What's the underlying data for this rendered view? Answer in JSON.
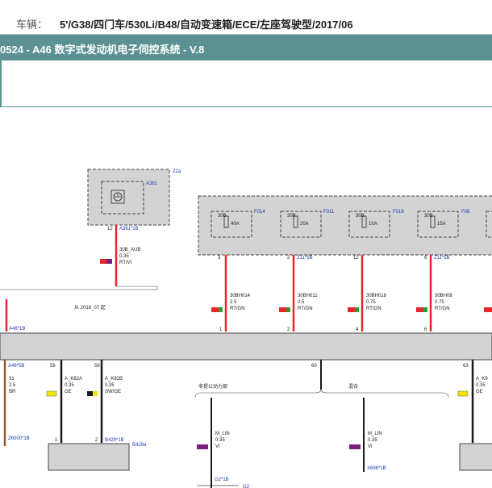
{
  "vehicle": {
    "label": "车辆：",
    "value": "5'/G38/四门车/530Li/B48/自动变速箱/ECE/左座驾驶型/2017/06"
  },
  "title": "0524 - A46 数字式发动机电子伺控系统 - V.8",
  "colors": {
    "title_bg": "#5b9193",
    "wire_red": "#e8252a",
    "wire_black": "#1a1a1a",
    "wire_brown": "#8b5a2b",
    "component_fill": "#d3d3d3"
  },
  "component_z2a": {
    "ref": "Z2a",
    "connector": "A361",
    "connector_pin": "A361*1B",
    "pin": "12",
    "icon": "ground-symbol-icon"
  },
  "wire_a361": {
    "name": "30B_AUB",
    "gauge": "0.35",
    "color": "RT/VI"
  },
  "note_2016": "从 2016_07 起",
  "fuses": [
    {
      "ref": "F014",
      "label": "30B",
      "rating": "40A",
      "pin": "3",
      "wire": "30BH014",
      "gauge": "2.5",
      "color": "RT/GN",
      "bottom_pin": "1"
    },
    {
      "ref": "F011",
      "label": "30B",
      "rating": "20A",
      "pin": "2",
      "connector": "Z11*5B",
      "wire": "30BH011",
      "gauge": "2.5",
      "color": "RT/GN",
      "bottom_pin": "2"
    },
    {
      "ref": "F018",
      "label": "30B",
      "rating": "10A",
      "pin": "12",
      "wire": "30BH018",
      "gauge": "0.75",
      "color": "RT/GN",
      "bottom_pin": "4"
    },
    {
      "ref": "F08",
      "label": "30B",
      "rating": "15A",
      "pin": "6",
      "connector": "Z11*5B",
      "wire": "30BH08",
      "gauge": "0.75",
      "color": "RT/GN",
      "bottom_pin": "6"
    }
  ],
  "main_bus": {
    "top_connector": "A46*1B",
    "left_connector": "A46*5B",
    "pins": [
      "31",
      "58",
      "59",
      "60",
      "63"
    ],
    "left_wires": [
      {
        "name": "31",
        "gauge": "2.5",
        "color": "BR",
        "end_connector": "Z6000*1B"
      },
      {
        "name": "A_K82A",
        "gauge": "0.35",
        "color": "GE",
        "end_pin": "1"
      },
      {
        "name": "A_K82B",
        "gauge": "0.35",
        "color": "SW/GE",
        "end_pin": "2",
        "end_connector": "B429*1B"
      }
    ],
    "end_component": "B429a",
    "right_wire": {
      "name": "A_K9",
      "gauge": "0.35",
      "color": "GE"
    }
  },
  "lin": {
    "label_left": "非提公动力部",
    "label_right": "混合",
    "wires": [
      {
        "name": "M_LIN",
        "gauge": "0.35",
        "color": "VI",
        "end_connector": "G2*1B"
      },
      {
        "name": "M_LIN",
        "gauge": "0.35",
        "color": "VI",
        "end_connector": "X698*1B"
      }
    ],
    "bottom_component": "G2"
  }
}
